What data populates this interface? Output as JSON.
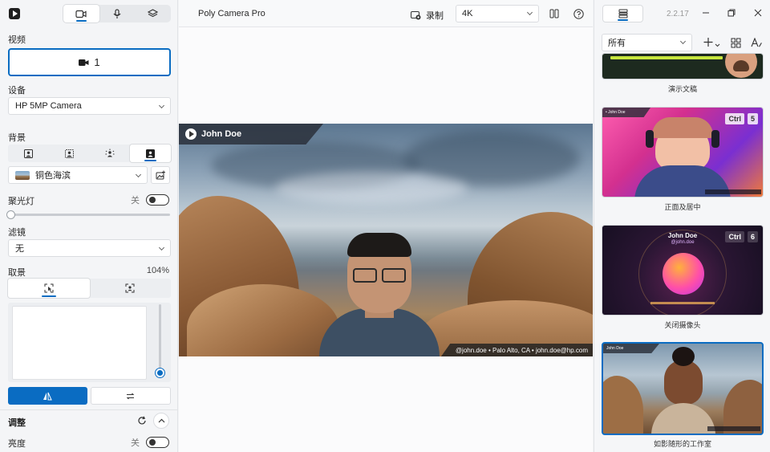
{
  "left_panel": {
    "section_video": "视频",
    "video_button_label": "1",
    "section_device": "设备",
    "device_value": "HP 5MP Camera",
    "section_background": "背景",
    "background_value": "铜色海滨",
    "section_spotlight": "聚光灯",
    "spotlight_state": "关",
    "spotlight_level": 0,
    "section_filter": "滤镜",
    "filter_value": "无",
    "section_framing": "取景",
    "framing_zoom": "104%",
    "zoom_slider_level": 0,
    "section_adjust": "调整",
    "brightness_label": "亮度",
    "brightness_state": "关"
  },
  "center": {
    "app_title": "Poly Camera Pro",
    "record_label": "录制",
    "resolution_value": "4K",
    "preview": {
      "name_tag": "John Doe",
      "info_text": "@john.doe • Palo Alto, CA • john.doe@hp.com"
    }
  },
  "right_panel": {
    "version": "2.2.17",
    "filter_value": "所有",
    "scenes": [
      {
        "label": "演示文稿"
      },
      {
        "label": "正面及居中",
        "key1": "Ctrl",
        "key2": "5"
      },
      {
        "label": "关闭摄像头",
        "key1": "Ctrl",
        "key2": "6",
        "card_name": "John Doe",
        "card_handle": "@john.doe"
      },
      {
        "label": "如影随形的工作室",
        "mini_name": "John Doe"
      }
    ]
  },
  "colors": {
    "accent": "#0a6cc2",
    "panel_bg": "#f4f5f7"
  }
}
